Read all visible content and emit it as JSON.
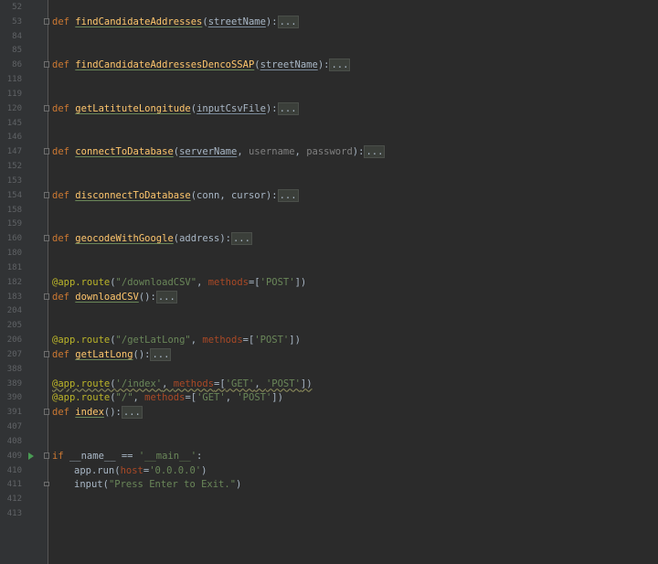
{
  "editor": {
    "lines": [
      {
        "n": "52",
        "code": []
      },
      {
        "n": "53",
        "fold": true,
        "code": [
          [
            "kw",
            "def "
          ],
          [
            "fn",
            "findCandidateAddresses"
          ],
          [
            "pl",
            "("
          ],
          [
            "param",
            "streetName"
          ],
          [
            "pl",
            "):"
          ],
          [
            "ph",
            "..."
          ]
        ]
      },
      {
        "n": "84",
        "code": []
      },
      {
        "n": "85",
        "code": []
      },
      {
        "n": "86",
        "fold": true,
        "code": [
          [
            "kw",
            "def "
          ],
          [
            "fn",
            "findCandidateAddressesDencoSSAP"
          ],
          [
            "pl",
            "("
          ],
          [
            "param",
            "streetName"
          ],
          [
            "pl",
            "):"
          ],
          [
            "ph",
            "..."
          ]
        ]
      },
      {
        "n": "118",
        "code": []
      },
      {
        "n": "119",
        "code": []
      },
      {
        "n": "120",
        "fold": true,
        "code": [
          [
            "kw",
            "def "
          ],
          [
            "fn",
            "getLatituteLongitude"
          ],
          [
            "pl",
            "("
          ],
          [
            "param",
            "inputCsvFile"
          ],
          [
            "pl",
            "):"
          ],
          [
            "ph",
            "..."
          ]
        ]
      },
      {
        "n": "145",
        "code": []
      },
      {
        "n": "146",
        "code": []
      },
      {
        "n": "147",
        "fold": true,
        "code": [
          [
            "kw",
            "def "
          ],
          [
            "fn",
            "connectToDatabase"
          ],
          [
            "pl",
            "("
          ],
          [
            "param",
            "serverName"
          ],
          [
            "pl",
            ", "
          ],
          [
            "gray",
            "username"
          ],
          [
            "pl",
            ", "
          ],
          [
            "gray",
            "password"
          ],
          [
            "pl",
            "):"
          ],
          [
            "ph",
            "..."
          ]
        ]
      },
      {
        "n": "152",
        "code": []
      },
      {
        "n": "153",
        "code": []
      },
      {
        "n": "154",
        "fold": true,
        "code": [
          [
            "kw",
            "def "
          ],
          [
            "fn",
            "disconnectToDatabase"
          ],
          [
            "pl",
            "(conn, cursor):"
          ],
          [
            "ph",
            "..."
          ]
        ]
      },
      {
        "n": "158",
        "code": []
      },
      {
        "n": "159",
        "code": []
      },
      {
        "n": "160",
        "fold": true,
        "code": [
          [
            "kw",
            "def "
          ],
          [
            "fn",
            "geocodeWithGoogle"
          ],
          [
            "pl",
            "(address):"
          ],
          [
            "ph",
            "..."
          ]
        ]
      },
      {
        "n": "180",
        "code": []
      },
      {
        "n": "181",
        "code": []
      },
      {
        "n": "182",
        "code": [
          [
            "dec",
            "@app.route"
          ],
          [
            "pl",
            "("
          ],
          [
            "str",
            "\"/downloadCSV\""
          ],
          [
            "pl",
            ", "
          ],
          [
            "kwarg",
            "methods"
          ],
          [
            "pl",
            "=["
          ],
          [
            "str",
            "'POST'"
          ],
          [
            "pl",
            "])"
          ]
        ]
      },
      {
        "n": "183",
        "fold": true,
        "code": [
          [
            "kw",
            "def "
          ],
          [
            "fn",
            "downloadCSV"
          ],
          [
            "pl",
            "():"
          ],
          [
            "ph",
            "..."
          ]
        ]
      },
      {
        "n": "204",
        "code": []
      },
      {
        "n": "205",
        "code": []
      },
      {
        "n": "206",
        "code": [
          [
            "dec",
            "@app.route"
          ],
          [
            "pl",
            "("
          ],
          [
            "str",
            "\"/getLatLong\""
          ],
          [
            "pl",
            ", "
          ],
          [
            "kwarg",
            "methods"
          ],
          [
            "pl",
            "=["
          ],
          [
            "str",
            "'POST'"
          ],
          [
            "pl",
            "])"
          ]
        ]
      },
      {
        "n": "207",
        "fold": true,
        "code": [
          [
            "kw",
            "def "
          ],
          [
            "fn",
            "getLatLong"
          ],
          [
            "pl",
            "():"
          ],
          [
            "ph",
            "..."
          ]
        ]
      },
      {
        "n": "388",
        "code": []
      },
      {
        "n": "389",
        "wavy": true,
        "code": [
          [
            "dec",
            "@app.route"
          ],
          [
            "pl",
            "("
          ],
          [
            "str",
            "'/index'"
          ],
          [
            "pl",
            ", "
          ],
          [
            "kwarg",
            "methods"
          ],
          [
            "pl",
            "=["
          ],
          [
            "str",
            "'GET'"
          ],
          [
            "pl",
            ", "
          ],
          [
            "str",
            "'POST'"
          ],
          [
            "pl",
            "])"
          ]
        ]
      },
      {
        "n": "390",
        "code": [
          [
            "dec",
            "@app.route"
          ],
          [
            "pl",
            "("
          ],
          [
            "str",
            "\"/\""
          ],
          [
            "pl",
            ", "
          ],
          [
            "kwarg",
            "methods"
          ],
          [
            "pl",
            "=["
          ],
          [
            "str",
            "'GET'"
          ],
          [
            "pl",
            ", "
          ],
          [
            "str",
            "'POST'"
          ],
          [
            "pl",
            "])"
          ]
        ]
      },
      {
        "n": "391",
        "fold": true,
        "code": [
          [
            "kw",
            "def "
          ],
          [
            "fnplain",
            "index"
          ],
          [
            "pl",
            "():"
          ],
          [
            "ph",
            "..."
          ]
        ]
      },
      {
        "n": "407",
        "code": []
      },
      {
        "n": "408",
        "code": []
      },
      {
        "n": "409",
        "fold": true,
        "run": true,
        "code": [
          [
            "kw",
            "if "
          ],
          [
            "pl",
            "__name__ == "
          ],
          [
            "str",
            "'__main__'"
          ],
          [
            "pl",
            ":"
          ]
        ]
      },
      {
        "n": "410",
        "indent": true,
        "code": [
          [
            "pl",
            "app.run("
          ],
          [
            "kwarg",
            "host"
          ],
          [
            "pl",
            "="
          ],
          [
            "str",
            "'0.0.0.0'"
          ],
          [
            "pl",
            ")"
          ]
        ]
      },
      {
        "n": "411",
        "indent": true,
        "foldEnd": true,
        "code": [
          [
            "pl",
            "input("
          ],
          [
            "str",
            "\"Press Enter to Exit.\""
          ],
          [
            "pl",
            ")"
          ]
        ]
      },
      {
        "n": "412",
        "code": []
      },
      {
        "n": "413",
        "code": []
      }
    ]
  }
}
